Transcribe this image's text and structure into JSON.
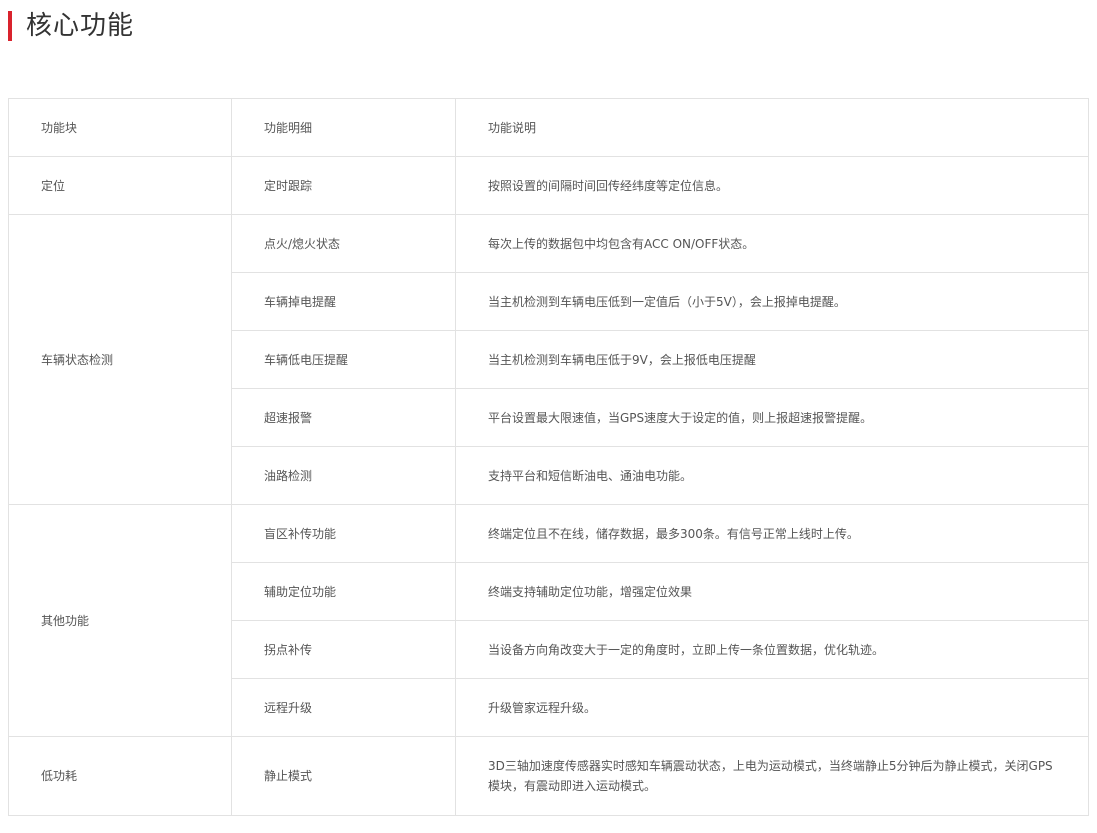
{
  "page": {
    "title": "核心功能"
  },
  "table": {
    "headers": [
      "功能块",
      "功能明细",
      "功能说明"
    ],
    "groups": [
      {
        "block": "定位",
        "rows": [
          {
            "detail": "定时跟踪",
            "desc": "按照设置的间隔时间回传经纬度等定位信息。"
          }
        ]
      },
      {
        "block": "车辆状态检测",
        "rows": [
          {
            "detail": "点火/熄火状态",
            "desc": "每次上传的数据包中均包含有ACC ON/OFF状态。"
          },
          {
            "detail": "车辆掉电提醒",
            "desc": "当主机检测到车辆电压低到一定值后（小于5V），会上报掉电提醒。"
          },
          {
            "detail": "车辆低电压提醒",
            "desc": "当主机检测到车辆电压低于9V，会上报低电压提醒"
          },
          {
            "detail": "超速报警",
            "desc": "平台设置最大限速值，当GPS速度大于设定的值，则上报超速报警提醒。"
          },
          {
            "detail": "油路检测",
            "desc": "支持平台和短信断油电、通油电功能。"
          }
        ]
      },
      {
        "block": "其他功能",
        "rows": [
          {
            "detail": "盲区补传功能",
            "desc": "终端定位且不在线，储存数据，最多300条。有信号正常上线时上传。"
          },
          {
            "detail": "辅助定位功能",
            "desc": "终端支持辅助定位功能，增强定位效果"
          },
          {
            "detail": "拐点补传",
            "desc": "当设备方向角改变大于一定的角度时，立即上传一条位置数据，优化轨迹。"
          },
          {
            "detail": "远程升级",
            "desc": "升级管家远程升级。"
          }
        ]
      },
      {
        "block": "低功耗",
        "rows": [
          {
            "detail": "静止模式",
            "desc": "3D三轴加速度传感器实时感知车辆震动状态，上电为运动模式，当终端静止5分钟后为静止模式，关闭GPS模块，有震动即进入运动模式。"
          }
        ]
      }
    ]
  },
  "colors": {
    "accent": "#d9232d",
    "border": "#e2e2e2",
    "text": "#555555",
    "title": "#333333"
  }
}
